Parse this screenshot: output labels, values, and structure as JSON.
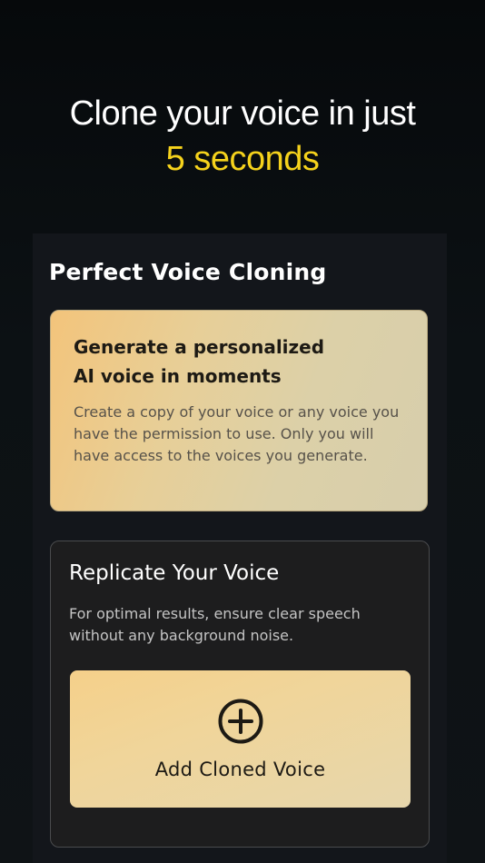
{
  "hero": {
    "line1": "Clone your voice in just",
    "line2": "5 seconds"
  },
  "panel": {
    "title": "Perfect Voice Cloning"
  },
  "info_card": {
    "heading_line1": "Generate a personalized",
    "heading_line2": "AI voice in moments",
    "description": "Create a copy of your voice or any voice you have the permission to use. Only you will have access to the voices you generate."
  },
  "replicate_card": {
    "heading": "Replicate Your Voice",
    "description": "For optimal results, ensure clear speech without any background noise.",
    "button_label": "Add Cloned Voice",
    "button_icon": "plus-circle-icon"
  },
  "colors": {
    "accent_yellow": "#f5d21c",
    "card_gold": "#e7cf98",
    "background": "#0c1114"
  }
}
